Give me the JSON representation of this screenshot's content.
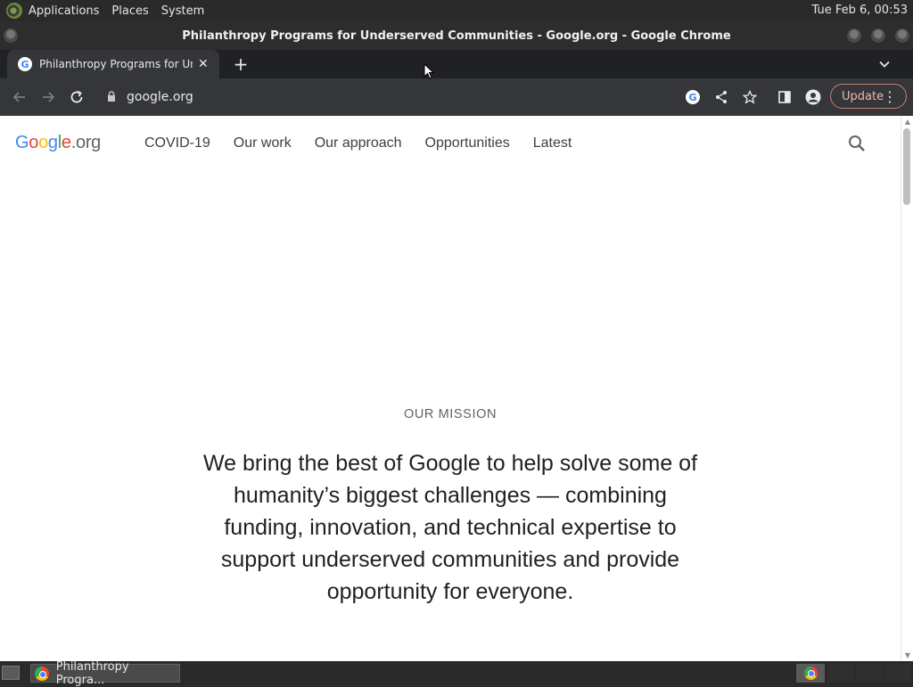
{
  "os": {
    "menus": [
      "Applications",
      "Places",
      "System"
    ],
    "clock": "Tue Feb  6, 00:53"
  },
  "window": {
    "title": "Philanthropy Programs for Underserved Communities - Google.org - Google Chrome"
  },
  "tab": {
    "title": "Philanthropy Programs for Underserved Communities - Google.org",
    "favicon": "G"
  },
  "toolbar": {
    "url": "google.org",
    "update_label": "Update"
  },
  "site": {
    "logo_parts": [
      "G",
      "o",
      "o",
      "g",
      "l",
      "e",
      ".org"
    ],
    "nav": [
      "COVID-19",
      "Our work",
      "Our approach",
      "Opportunities",
      "Latest"
    ]
  },
  "mission": {
    "label": "OUR MISSION",
    "text": "We bring the best of Google to help solve some of humanity’s biggest challenges — combining funding, innovation, and technical expertise to support underserved communities and provide opportunity for everyone."
  },
  "taskbar": {
    "item_label": "Philanthropy Progra..."
  },
  "colors": {
    "accent_update": "#f0b7ac",
    "google_blue": "#4285f4",
    "google_red": "#ea4335",
    "google_yellow": "#fbbc05",
    "google_green": "#34a853"
  }
}
